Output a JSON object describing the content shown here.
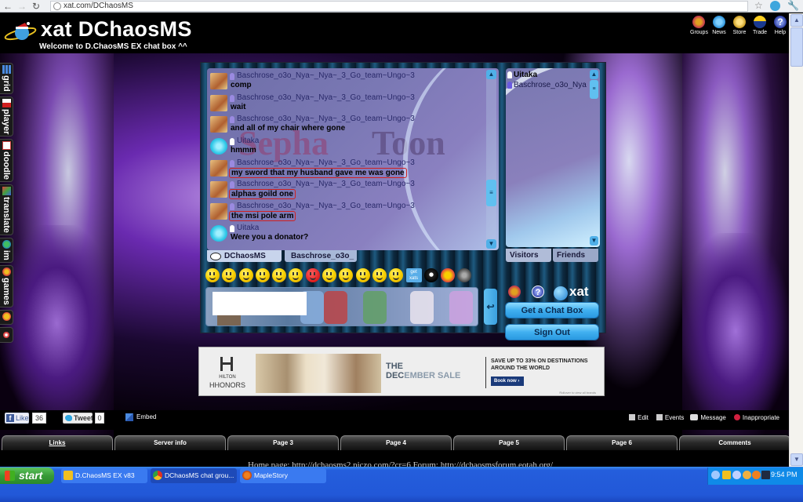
{
  "browser": {
    "url": "xat.com/DChaosMS",
    "back_icon": "arrow-left-icon",
    "forward_icon": "arrow-right-icon",
    "reload_icon": "reload-icon",
    "bookmark_icon": "star-icon",
    "extension_icon": "skype-icon",
    "menu_icon": "wrench-icon"
  },
  "header": {
    "title": "xat DChaosMS",
    "subtitle": "Welcome to D.ChaosMS EX chat box ^^",
    "nav": [
      {
        "label": "Groups",
        "icon": "groups-icon"
      },
      {
        "label": "News",
        "icon": "news-icon"
      },
      {
        "label": "Store",
        "icon": "store-icon"
      },
      {
        "label": "Trade",
        "icon": "trade-icon"
      },
      {
        "label": "Help",
        "icon": "help-icon"
      }
    ]
  },
  "side_tabs": [
    {
      "label": "grid",
      "icon": "grid-icon"
    },
    {
      "label": "player",
      "icon": "youtube-icon"
    },
    {
      "label": "doodle",
      "icon": "doodle-icon"
    },
    {
      "label": "translate",
      "icon": "translate-icon"
    },
    {
      "label": "im",
      "icon": "im-icon"
    },
    {
      "label": "games",
      "icon": "games-icon"
    },
    {
      "label": "",
      "icon": "smilies-icon"
    },
    {
      "label": "",
      "icon": "close-icon"
    }
  ],
  "chat": {
    "watermark_left": "Sepha",
    "watermark_right": "Toon",
    "messages": [
      {
        "user": "Baschrose_o3o_Nya~_Nya~_3_Go_team~Ungo~3",
        "text": "comp",
        "avatar": "baschrose",
        "highlight": false
      },
      {
        "user": "Baschrose_o3o_Nya~_Nya~_3_Go_team~Ungo~3",
        "text": "wait",
        "avatar": "baschrose",
        "highlight": false
      },
      {
        "user": "Baschrose_o3o_Nya~_Nya~_3_Go_team~Ungo~3",
        "text": "and all of my chair where gone",
        "avatar": "baschrose",
        "highlight": false
      },
      {
        "user": "Uitaka",
        "text": "hmmm",
        "avatar": "uitaka",
        "highlight": false
      },
      {
        "user": "Baschrose_o3o_Nya~_Nya~_3_Go_team~Ungo~3",
        "text": "my sword that my husband gave me was gone",
        "avatar": "baschrose",
        "highlight": true
      },
      {
        "user": "Baschrose_o3o_Nya~_Nya~_3_Go_team~Ungo~3",
        "text": "alphas goild one",
        "avatar": "baschrose",
        "highlight": true
      },
      {
        "user": "Baschrose_o3o_Nya~_Nya~_3_Go_team~Ungo~3",
        "text": "the msi pole arm",
        "avatar": "baschrose",
        "highlight": true
      },
      {
        "user": "Uitaka",
        "text": "Were you a donator?",
        "avatar": "uitaka",
        "highlight": false
      }
    ],
    "tabs": [
      {
        "label": "DChaosMS",
        "icon": "speech-bubble-icon",
        "active": true
      },
      {
        "label": "Baschrose_o3o_",
        "icon": "lock-icon",
        "active": false
      }
    ],
    "smileys": [
      "smile",
      "biggrin",
      "wink",
      "eek",
      "tongue",
      "cool",
      "mad",
      "confused",
      "redface",
      "frown",
      "crying",
      "sleepy",
      "get xats",
      "8ball",
      "more-smilies",
      "sound"
    ],
    "getxats_label": "get xats",
    "input_value": "",
    "send_icon": "enter-arrow-icon",
    "scroll_up": "▲",
    "scroll_down": "▼",
    "scroll_grip": "≡"
  },
  "users": {
    "list": [
      {
        "name": "Uitaka",
        "bold": true,
        "registered": false
      },
      {
        "name": "Baschrose_o3o_Nya",
        "bold": false,
        "registered": true
      }
    ],
    "tabs": [
      {
        "label": "Visitors",
        "active": true
      },
      {
        "label": "Friends",
        "active": false
      }
    ],
    "brand": "xat",
    "help_glyph": "?",
    "get_chat_box": "Get a Chat Box",
    "sign_out": "Sign Out"
  },
  "ad": {
    "brand_top": "HILTON",
    "brand": "HHONORS",
    "headline_1": "THE",
    "headline_2a": "DEC",
    "headline_2b": "EMBER SALE",
    "offer": "SAVE UP TO 33% ON DESTINATIONS AROUND THE WORLD",
    "cta": "Book now ›",
    "rollover": "Rollover to view all brands"
  },
  "social": {
    "like_label": "Like",
    "like_count": "36",
    "tweet_label": "Tweet",
    "tweet_count": "0",
    "embed_label": "Embed",
    "actions": [
      {
        "label": "Edit",
        "icon": "edit-icon"
      },
      {
        "label": "Events",
        "icon": "events-icon"
      },
      {
        "label": "Message",
        "icon": "message-icon"
      },
      {
        "label": "Inappropriate",
        "icon": "inappropriate-icon"
      }
    ]
  },
  "page_tabs": [
    {
      "label": "Links",
      "active": true
    },
    {
      "label": "Server info",
      "active": false
    },
    {
      "label": "Page 3",
      "active": false
    },
    {
      "label": "Page 4",
      "active": false
    },
    {
      "label": "Page 5",
      "active": false
    },
    {
      "label": "Page 6",
      "active": false
    },
    {
      "label": "Comments",
      "active": false
    }
  ],
  "links_text": "Home page: http://dchaosms2.piczo.com/?cr=6 Forum: http://dchaosmsforum.eotah.org/",
  "taskbar": {
    "start_label": "start",
    "items": [
      {
        "label": "D.ChaosMS EX v83",
        "icon": "star-icon",
        "active": false
      },
      {
        "label": "DChaosMS chat grou...",
        "icon": "chrome-icon",
        "active": true
      },
      {
        "label": "MapleStory",
        "icon": "maplestory-icon",
        "active": false
      }
    ],
    "clock": "9:54 PM"
  }
}
